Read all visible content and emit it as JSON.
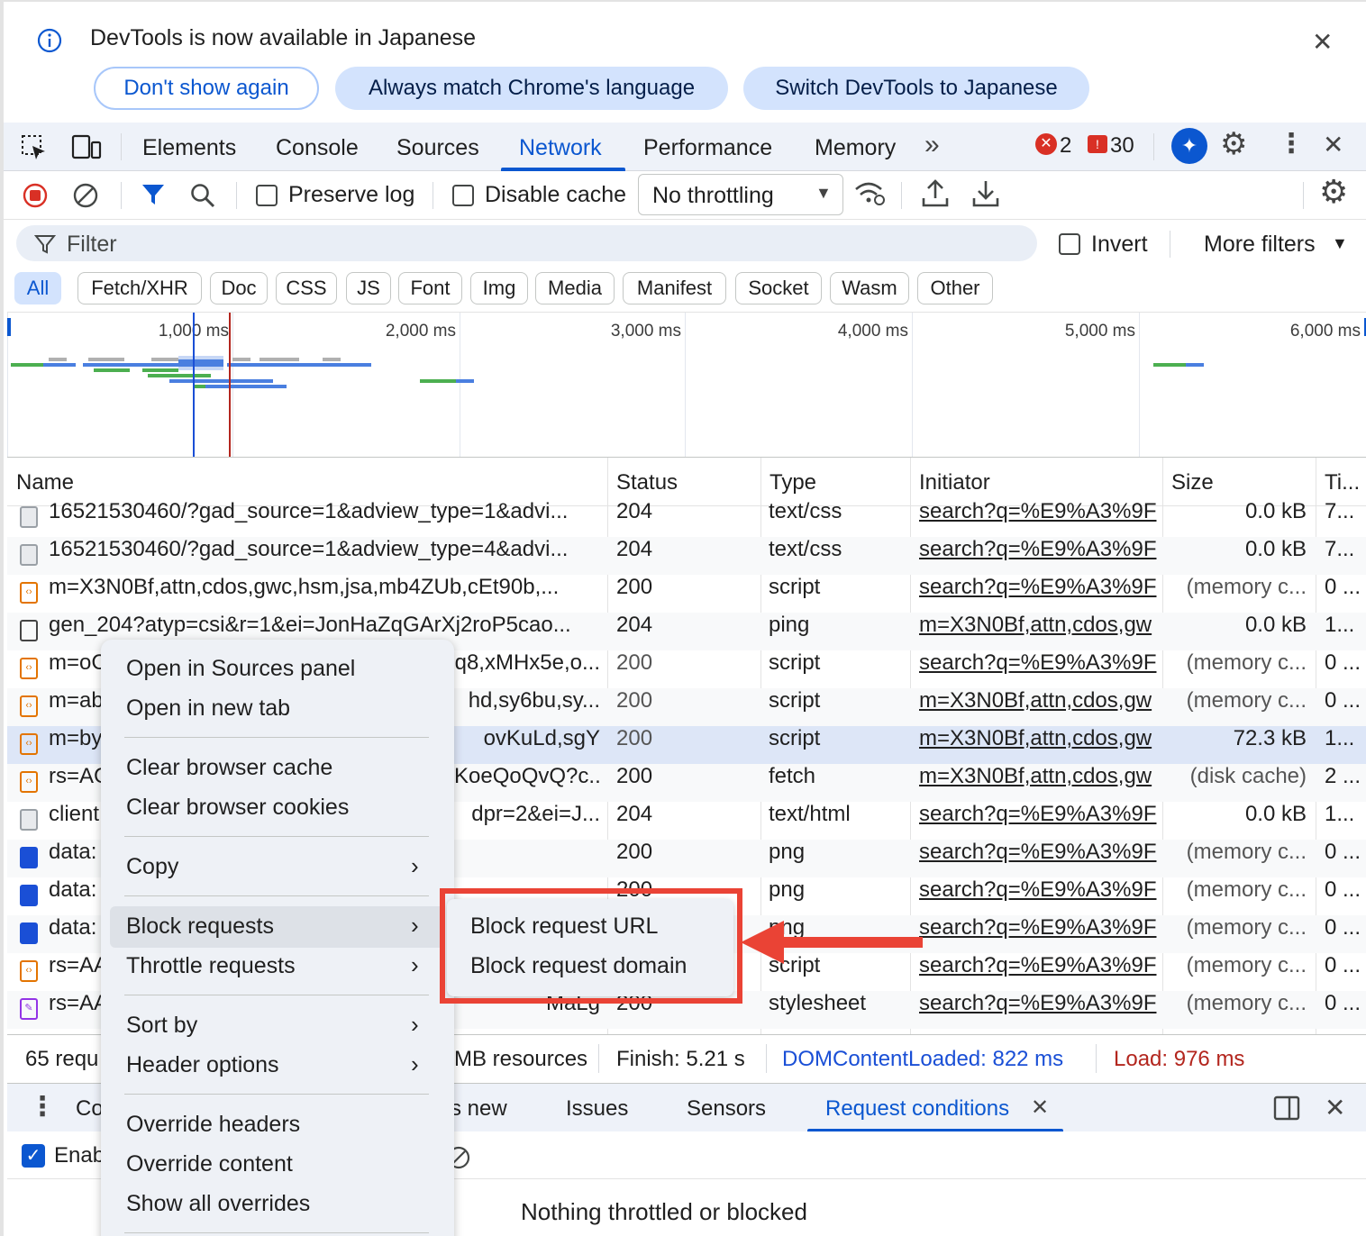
{
  "infobar": {
    "message": "DevTools is now available in Japanese",
    "buttons": [
      "Don't show again",
      "Always match Chrome's language",
      "Switch DevTools to Japanese"
    ]
  },
  "tabs": [
    "Elements",
    "Console",
    "Sources",
    "Network",
    "Performance",
    "Memory"
  ],
  "active_tab": "Network",
  "issues": {
    "errors": "2",
    "messages": "30"
  },
  "toolbar": {
    "preserve_log": "Preserve log",
    "disable_cache": "Disable cache",
    "throttling": "No throttling"
  },
  "filter": {
    "placeholder": "Filter",
    "invert": "Invert",
    "more_filters": "More filters"
  },
  "type_filters": [
    "All",
    "Fetch/XHR",
    "Doc",
    "CSS",
    "JS",
    "Font",
    "Img",
    "Media",
    "Manifest",
    "Socket",
    "Wasm",
    "Other"
  ],
  "timeline_ticks": [
    "1,000 ms",
    "2,000 ms",
    "3,000 ms",
    "4,000 ms",
    "5,000 ms",
    "6,000 ms"
  ],
  "columns": [
    "Name",
    "Status",
    "Type",
    "Initiator",
    "Size",
    "Ti..."
  ],
  "rows": [
    {
      "name": "16521530460/?gad_source=1&adview_type=1&advi...",
      "status": "204",
      "type": "text/css",
      "initiator": "search?q=%E9%A3%9F",
      "size": "0.0 kB",
      "time": "7..."
    },
    {
      "name": "16521530460/?gad_source=1&adview_type=4&advi...",
      "status": "204",
      "type": "text/css",
      "initiator": "search?q=%E9%A3%9F",
      "size": "0.0 kB",
      "time": "7..."
    },
    {
      "name": "m=X3N0Bf,attn,cdos,gwc,hsm,jsa,mb4ZUb,cEt90b,...",
      "status": "200",
      "type": "script",
      "initiator": "search?q=%E9%A3%9F",
      "size": "(memory c...",
      "time": "0 ..."
    },
    {
      "name": "gen_204?atyp=csi&r=1&ei=JonHaZqGArXj2roP5cao...",
      "status": "204",
      "type": "ping",
      "initiator": "m=X3N0Bf,attn,cdos,gw",
      "size": "0.0 kB",
      "time": "1..."
    },
    {
      "name": "m=oC",
      "name_tail": "q8,xMHx5e,o...",
      "status": "200",
      "type": "script",
      "initiator": "search?q=%E9%A3%9F",
      "size": "(memory c...",
      "time": "0 ..."
    },
    {
      "name": "m=ab",
      "name_tail": "hd,sy6bu,sy...",
      "status": "200",
      "type": "script",
      "initiator": "m=X3N0Bf,attn,cdos,gw",
      "size": "(memory c...",
      "time": "0 ..."
    },
    {
      "name": "m=by",
      "name_tail": "ovKuLd,sgY",
      "status": "200",
      "type": "script",
      "initiator": "m=X3N0Bf,attn,cdos,gw",
      "size": "72.3 kB",
      "time": "1..."
    },
    {
      "name": "rs=AC",
      "name_tail": "KoeQoQvQ?c...",
      "status": "200",
      "type": "fetch",
      "initiator": "m=X3N0Bf,attn,cdos,gw",
      "size": "(disk cache)",
      "time": "2 ..."
    },
    {
      "name": "client",
      "name_tail": "dpr=2&ei=J...",
      "status": "204",
      "type": "text/html",
      "initiator": "search?q=%E9%A3%9F",
      "size": "0.0 kB",
      "time": "1..."
    },
    {
      "name": "data:",
      "name_tail": "",
      "status": "200",
      "type": "png",
      "initiator": "search?q=%E9%A3%9F",
      "size": "(memory c...",
      "time": "0 ..."
    },
    {
      "name": "data:",
      "name_tail": "",
      "status": "200",
      "type": "png",
      "initiator": "search?q=%E9%A3%9F",
      "size": "(memory c...",
      "time": "0 ..."
    },
    {
      "name": "data:",
      "name_tail": "",
      "status": "200",
      "type": "png",
      "initiator": "search?q=%E9%A3%9F",
      "size": "(memory c...",
      "time": "0 ..."
    },
    {
      "name": "rs=AA",
      "name_tail": "",
      "status": "200",
      "type": "script",
      "initiator": "search?q=%E9%A3%9F",
      "size": "(memory c...",
      "time": "0 ..."
    },
    {
      "name": "rs=AA",
      "name_tail": "MaLg",
      "status": "200",
      "type": "stylesheet",
      "initiator": "search?q=%E9%A3%9F",
      "size": "(memory c...",
      "time": "0 ..."
    }
  ],
  "statusbar": {
    "requests": "65 requ",
    "resources": "MB resources",
    "finish": "Finish: 5.21 s",
    "domcontentloaded": "DOMContentLoaded: 822 ms",
    "load": "Load: 976 ms"
  },
  "drawer": {
    "tabs": [
      "Co",
      "s new",
      "Issues",
      "Sensors",
      "Request conditions"
    ],
    "active_tab": "Request conditions",
    "enable_label": "Enab",
    "empty_message": "Nothing throttled or blocked"
  },
  "context_menu": {
    "items": [
      "Open in Sources panel",
      "Open in new tab",
      "Clear browser cache",
      "Clear browser cookies",
      "Copy",
      "Block requests",
      "Throttle requests",
      "Sort by",
      "Header options",
      "Override headers",
      "Override content",
      "Show all overrides"
    ],
    "highlighted": "Block requests"
  },
  "submenu": {
    "items": [
      "Block request URL",
      "Block request domain"
    ]
  },
  "colors": {
    "accent": "#0b57d0",
    "annotation": "#ea4335",
    "error": "#d93025"
  }
}
